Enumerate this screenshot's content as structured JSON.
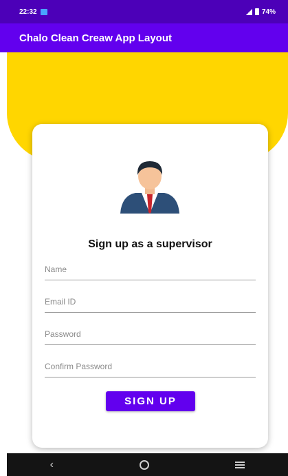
{
  "status_bar": {
    "time": "22:32",
    "battery": "74%"
  },
  "app_bar": {
    "title": "Chalo Clean Creaw App Layout"
  },
  "form": {
    "heading": "Sign up as a supervisor",
    "fields": [
      {
        "placeholder": "Name",
        "value": ""
      },
      {
        "placeholder": "Email ID",
        "value": ""
      },
      {
        "placeholder": "Password",
        "value": ""
      },
      {
        "placeholder": "Confirm Password",
        "value": ""
      }
    ],
    "submit_label": "SIGN UP"
  },
  "nav": {
    "back_icon": "chevron-left-icon",
    "home_icon": "circle-home-icon",
    "recent_icon": "menu-lines-icon"
  },
  "colors": {
    "status_bar": "#4c00b8",
    "app_bar": "#6200ee",
    "header_bg": "#ffd600",
    "button": "#6200ee"
  }
}
